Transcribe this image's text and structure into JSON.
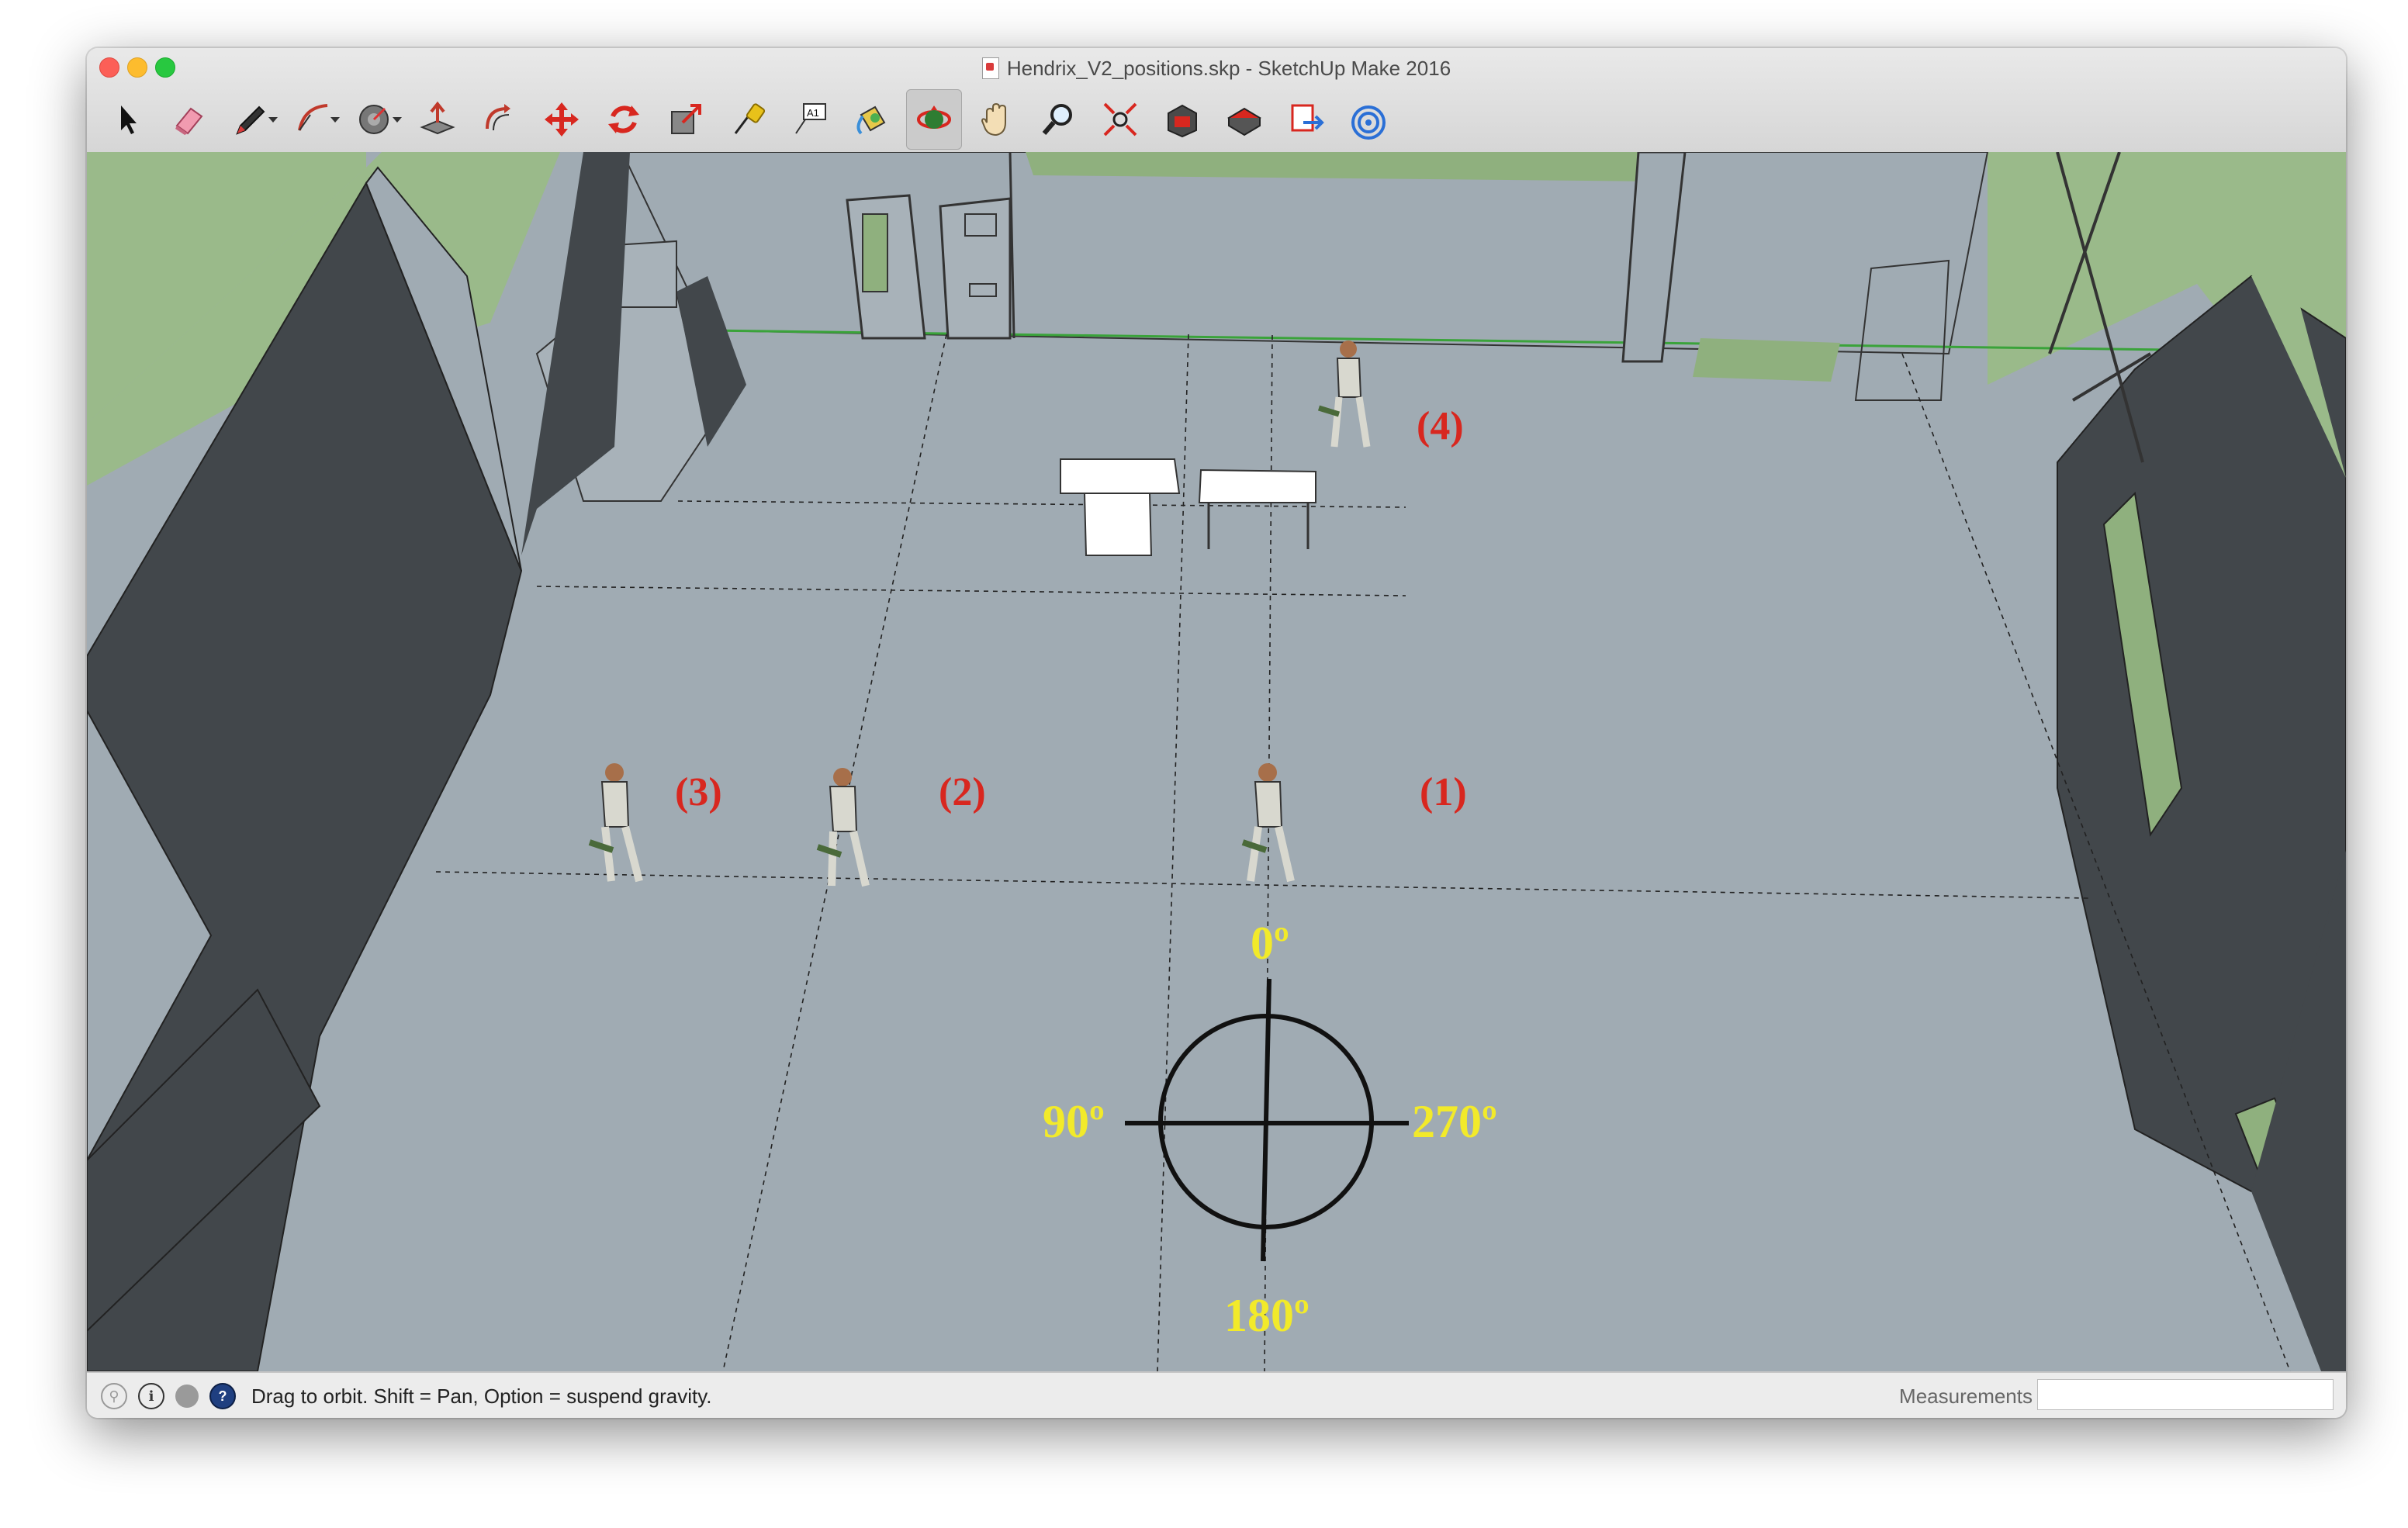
{
  "window": {
    "title": "Hendrix_V2_positions.skp - SketchUp Make 2016"
  },
  "toolbar": {
    "tools": [
      {
        "name": "select-tool"
      },
      {
        "name": "eraser-tool"
      },
      {
        "name": "pencil-tool"
      },
      {
        "name": "arc-tool"
      },
      {
        "name": "shape-tool"
      },
      {
        "name": "push-pull-tool"
      },
      {
        "name": "offset-tool"
      },
      {
        "name": "move-tool"
      },
      {
        "name": "rotate-tool"
      },
      {
        "name": "scale-tool"
      },
      {
        "name": "tape-measure-tool"
      },
      {
        "name": "text-tool"
      },
      {
        "name": "paint-bucket-tool"
      },
      {
        "name": "orbit-tool",
        "active": true
      },
      {
        "name": "pan-tool"
      },
      {
        "name": "zoom-tool"
      },
      {
        "name": "zoom-extents-tool"
      },
      {
        "name": "3d-warehouse-tool"
      },
      {
        "name": "extension-warehouse-tool"
      },
      {
        "name": "layout-send-tool"
      },
      {
        "name": "extension-manager-tool"
      }
    ]
  },
  "scene": {
    "positions": [
      "(1)",
      "(2)",
      "(3)",
      "(4)"
    ],
    "compass": {
      "top": "0º",
      "left": "90º",
      "right": "270º",
      "bottom": "180º"
    }
  },
  "statusbar": {
    "message": "Drag to orbit. Shift = Pan, Option = suspend gravity.",
    "measurements_label": "Measurements",
    "measurements_value": ""
  },
  "colors": {
    "floor": "#a0abb3",
    "wall_dark": "#42474b",
    "grass": "#9aba8a",
    "label_red": "#d8271f",
    "label_yellow": "#f2ea2a"
  }
}
